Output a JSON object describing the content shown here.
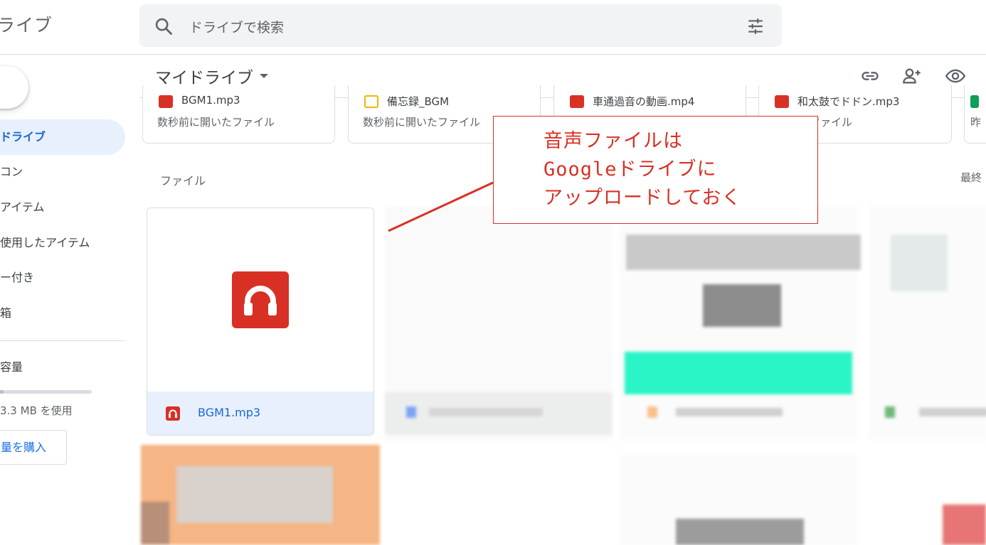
{
  "app": {
    "title": "ライブ"
  },
  "search": {
    "placeholder": "ドライブで検索"
  },
  "sidebar": {
    "items": [
      {
        "label": "ドライブ",
        "active": true
      },
      {
        "label": "コン"
      },
      {
        "label": "アイテム"
      },
      {
        "label": "使用したアイテム"
      },
      {
        "label": "ー付き"
      },
      {
        "label": "箱"
      }
    ],
    "storage_label": "容量",
    "storage_text": "3.3 MB を使用",
    "buy_label": "量を購入"
  },
  "main": {
    "title": "マイドライブ",
    "icons": [
      "link-icon",
      "share-person-icon",
      "eye-icon"
    ],
    "quick_access": [
      {
        "name": "BGM1.mp3",
        "sub": "数秒前に開いたファイル",
        "icon": "audio-icon",
        "color": "#d93025"
      },
      {
        "name": "備忘録_BGM",
        "sub": "数秒前に開いたファイル",
        "icon": "slides-icon",
        "color": "#f4b400"
      },
      {
        "name": "車通過音の動画.mp4",
        "sub": "",
        "icon": "video-icon",
        "color": "#d93025"
      },
      {
        "name": "和太鼓でドドン.mp3",
        "sub": "たファイル",
        "icon": "audio-icon",
        "color": "#d93025"
      },
      {
        "name": "",
        "sub": "昨",
        "icon": "sheets-icon",
        "color": "#0f9d58"
      }
    ],
    "section_label": "ファイル",
    "sort_label": "最終",
    "file_card": {
      "name": "BGM1.mp3",
      "icon": "headphones-icon"
    }
  },
  "annotation": {
    "lines": [
      "音声ファイルは",
      "Googleドライブに",
      "アップロードしておく"
    ],
    "color": "#d93025"
  }
}
